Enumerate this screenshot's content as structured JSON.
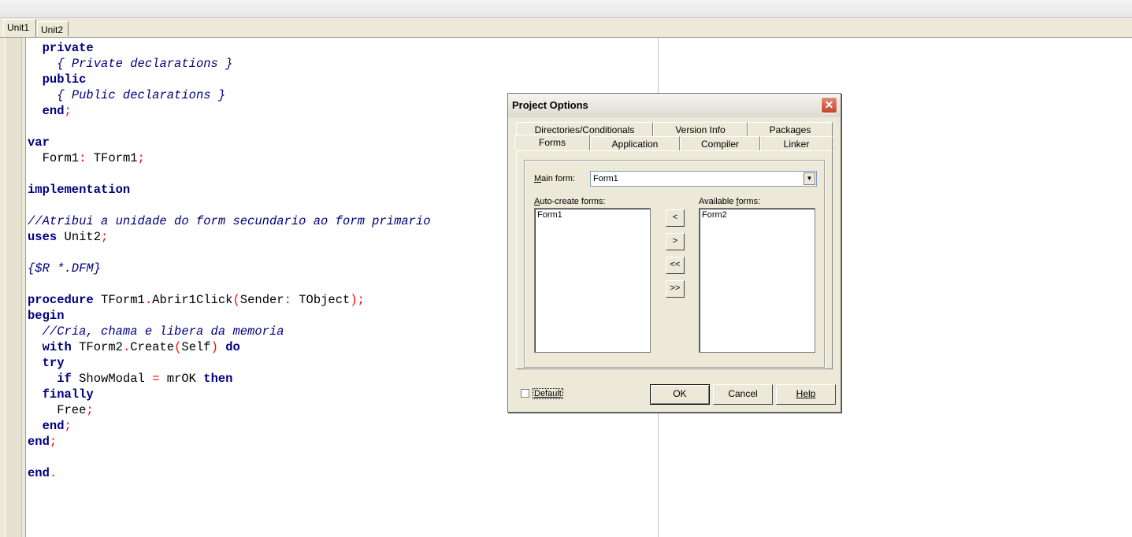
{
  "editor": {
    "tabs": [
      {
        "label": "Unit1",
        "active": true
      },
      {
        "label": "Unit2",
        "active": false
      }
    ],
    "code_lines": [
      [
        {
          "t": "  "
        },
        {
          "t": "private",
          "c": "kw"
        }
      ],
      [
        {
          "t": "    "
        },
        {
          "t": "{ Private declarations }",
          "c": "cm"
        }
      ],
      [
        {
          "t": "  "
        },
        {
          "t": "public",
          "c": "kw"
        }
      ],
      [
        {
          "t": "    "
        },
        {
          "t": "{ Public declarations }",
          "c": "cm"
        }
      ],
      [
        {
          "t": "  "
        },
        {
          "t": "end",
          "c": "kw"
        },
        {
          "t": ";",
          "c": "sy"
        }
      ],
      [],
      [
        {
          "t": "var",
          "c": "kw"
        }
      ],
      [
        {
          "t": "  Form1"
        },
        {
          "t": ":",
          "c": "sy"
        },
        {
          "t": " TForm1"
        },
        {
          "t": ";",
          "c": "sy"
        }
      ],
      [],
      [
        {
          "t": "implementation",
          "c": "kw"
        }
      ],
      [],
      [
        {
          "t": "//Atribui a unidade do form secundario ao form primario",
          "c": "cm"
        }
      ],
      [
        {
          "t": "uses",
          "c": "kw"
        },
        {
          "t": " Unit2"
        },
        {
          "t": ";",
          "c": "sy"
        }
      ],
      [],
      [
        {
          "t": "{$R *.DFM}",
          "c": "cm"
        }
      ],
      [],
      [
        {
          "t": "procedure",
          "c": "kw"
        },
        {
          "t": " TForm1"
        },
        {
          "t": ".",
          "c": "sy"
        },
        {
          "t": "Abrir1Click"
        },
        {
          "t": "(",
          "c": "sy"
        },
        {
          "t": "Sender"
        },
        {
          "t": ":",
          "c": "sy"
        },
        {
          "t": " TObject"
        },
        {
          "t": ");",
          "c": "sy"
        }
      ],
      [
        {
          "t": "begin",
          "c": "kw"
        }
      ],
      [
        {
          "t": "  "
        },
        {
          "t": "//Cria, chama e libera da memoria",
          "c": "cm"
        }
      ],
      [
        {
          "t": "  "
        },
        {
          "t": "with",
          "c": "kw"
        },
        {
          "t": " TForm2"
        },
        {
          "t": ".",
          "c": "sy"
        },
        {
          "t": "Create"
        },
        {
          "t": "(",
          "c": "sy"
        },
        {
          "t": "Self"
        },
        {
          "t": ")",
          "c": "sy"
        },
        {
          "t": " "
        },
        {
          "t": "do",
          "c": "kw"
        }
      ],
      [
        {
          "t": "  "
        },
        {
          "t": "try",
          "c": "kw"
        }
      ],
      [
        {
          "t": "    "
        },
        {
          "t": "if",
          "c": "kw"
        },
        {
          "t": " ShowModal "
        },
        {
          "t": "=",
          "c": "sy"
        },
        {
          "t": " mrOK "
        },
        {
          "t": "then",
          "c": "kw"
        }
      ],
      [
        {
          "t": "  "
        },
        {
          "t": "finally",
          "c": "kw"
        }
      ],
      [
        {
          "t": "    Free"
        },
        {
          "t": ";",
          "c": "sy"
        }
      ],
      [
        {
          "t": "  "
        },
        {
          "t": "end",
          "c": "kw"
        },
        {
          "t": ";",
          "c": "sy"
        }
      ],
      [
        {
          "t": "end",
          "c": "kw"
        },
        {
          "t": ";",
          "c": "sy"
        }
      ],
      [],
      [
        {
          "t": "end",
          "c": "kw"
        },
        {
          "t": ".",
          "c": "sy"
        }
      ]
    ]
  },
  "dialog": {
    "title": "Project Options",
    "close_icon": "close-icon",
    "tabs_back_row": [
      "Directories/Conditionals",
      "Version Info",
      "Packages"
    ],
    "tabs_front_row": [
      "Forms",
      "Application",
      "Compiler",
      "Linker"
    ],
    "selected_tab": "Forms",
    "main_form_label_accel": "M",
    "main_form_label_rest": "ain form:",
    "main_form_value": "Form1",
    "auto_create_label_accel": "A",
    "auto_create_label_rest": "uto-create forms:",
    "auto_create_items": [
      "Form1"
    ],
    "available_label_rest": "Available ",
    "available_label_accel": "f",
    "available_label_tail": "orms:",
    "available_items": [
      "Form2"
    ],
    "move_buttons": [
      "<",
      ">",
      "<<",
      ">>"
    ],
    "default_checkbox_label": "Default",
    "default_checked": false,
    "ok_label": "OK",
    "cancel_label": "Cancel",
    "help_label": "Help",
    "colors": {
      "keyword": "#000080",
      "comment": "#000080",
      "symbol": "#ff0000",
      "face": "#ece9d8"
    }
  }
}
